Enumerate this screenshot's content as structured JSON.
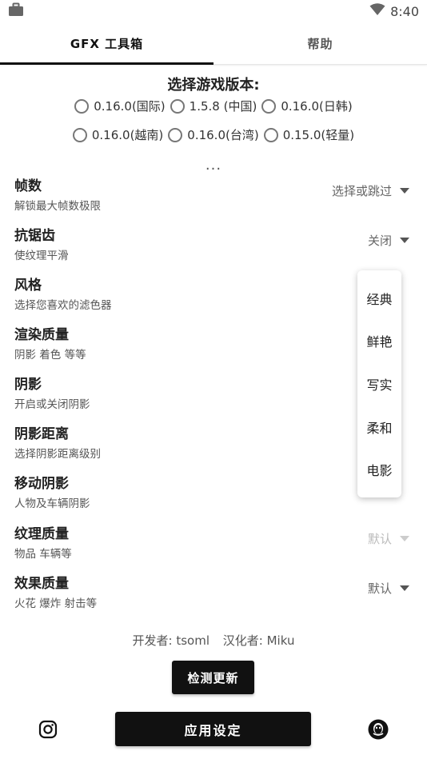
{
  "status_bar": {
    "time": "8:40",
    "left_icon": "briefcase-icon",
    "right_icon": "wifi-icon"
  },
  "tabs": [
    {
      "label": "GFX 工具箱",
      "active": true
    },
    {
      "label": "帮助",
      "active": false
    }
  ],
  "version": {
    "title": "选择游戏版本:",
    "row1": [
      "0.16.0(国际)",
      "1.5.8  (中国)",
      "0.16.0(日韩)"
    ],
    "row2": [
      "0.16.0(越南)",
      "0.16.0(台湾)",
      "0.15.0(轻量)"
    ],
    "more": "..."
  },
  "settings": [
    {
      "title": "帧数",
      "desc": "解锁最大帧数极限",
      "value": "选择或跳过"
    },
    {
      "title": "抗锯齿",
      "desc": "使纹理平滑",
      "value": "关闭"
    },
    {
      "title": "风格",
      "desc": "选择您喜欢的滤色器",
      "value": ""
    },
    {
      "title": "渲染质量",
      "desc": "阴影 着色 等等",
      "value": ""
    },
    {
      "title": "阴影",
      "desc": "开启或关闭阴影",
      "value": ""
    },
    {
      "title": "阴影距离",
      "desc": "选择阴影距离级别",
      "value": ""
    },
    {
      "title": "移动阴影",
      "desc": "人物及车辆阴影",
      "value": ""
    },
    {
      "title": "纹理质量",
      "desc": "物品 车辆等",
      "value": "默认"
    },
    {
      "title": "效果质量",
      "desc": "火花 爆炸 射击等",
      "value": "默认"
    }
  ],
  "style_menu": [
    "经典",
    "鲜艳",
    "写实",
    "柔和",
    "电影"
  ],
  "credits": {
    "developer": "开发者: tsoml",
    "translator": "汉化者: Miku"
  },
  "check_update_label": "检测更新",
  "apply_label": "应用设定"
}
